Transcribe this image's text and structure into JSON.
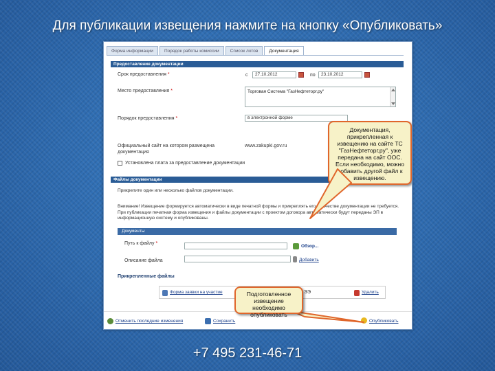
{
  "slide": {
    "title": "Для публикации извещения нажмите на кнопку «Опубликовать»",
    "phone": "+7 495 231-46-71"
  },
  "tabs": [
    {
      "label": "Форма информации"
    },
    {
      "label": "Порядок работы комиссии"
    },
    {
      "label": "Список лотов"
    },
    {
      "label": "Документация",
      "active": true
    }
  ],
  "provision": {
    "header": "Предоставление документации",
    "period_label": "Срок предоставления",
    "from_label": "с",
    "date_from": "27.10.2012",
    "to_label": "по",
    "date_to": "23.10.2012",
    "place_label": "Место предоставления",
    "place_value": "Торговая Система \"ГазНефтеторг.ру\"",
    "procedure_label": "Порядок предоставления",
    "procedure_value": "в электронной форме",
    "site_label": "Официальный сайт на котором размещена документация",
    "site_value": "www.zakupki.gov.ru",
    "fee_label": "Установлена плата за предоставление документации"
  },
  "files": {
    "header": "Файлы документации",
    "instruction": "Прикрепите один или несколько файлов документации.",
    "warning": "Внимание! Извещение формируется автоматически в виде печатной формы и прикреплять его в качестве документации не требуется. При публикации печатная форма извещения и файлы документации с проектом договора автоматически будут переданы ЭП в информационную систему и опубликованы.",
    "documents_header": "Документы",
    "path_label": "Путь к файлу",
    "browse_label": "Обзор...",
    "desc_label": "Описание файла",
    "add_label": "Добавить",
    "attached_label": "Прикрепленные файлы",
    "attached_file": "Форма заявки на участие",
    "attached_suffix": "ЭЭ",
    "delete_label": "Удалить"
  },
  "actions": {
    "cancel_label": "Отменить последние изменения",
    "save_label": "Сохранить",
    "publish_label": "Опубликовать"
  },
  "callouts": {
    "top": "Документация, прикрепленная к извещению на сайте ТС \"ГазНефтеторг.ру\", уже передана на сайт ООС. Если необходимо, можно добавить другой файл к извещению.",
    "bottom": "Подготовленное извещение необходимо опубликовать"
  },
  "colors": {
    "accent": "#2a5c96",
    "callout_bg": "#f7f2c8",
    "callout_border": "#e0662b"
  }
}
